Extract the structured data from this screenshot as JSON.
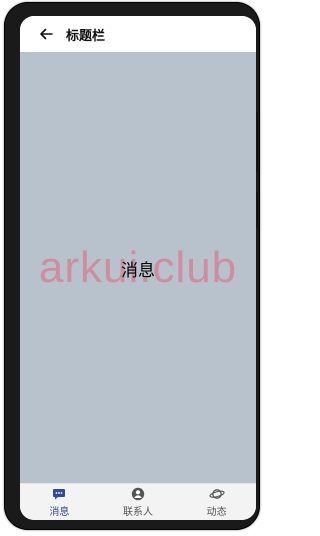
{
  "titlebar": {
    "title": "标题栏"
  },
  "content": {
    "label": "消息",
    "watermark": "arkui.club"
  },
  "tabs": [
    {
      "label": "消息",
      "icon": "message-icon",
      "active": true
    },
    {
      "label": "联系人",
      "icon": "contacts-icon",
      "active": false
    },
    {
      "label": "动态",
      "icon": "planet-icon",
      "active": false
    }
  ],
  "colors": {
    "content_bg": "#b7c2cd",
    "active_tab": "#2f4aa0",
    "inactive_tab": "#555555"
  }
}
